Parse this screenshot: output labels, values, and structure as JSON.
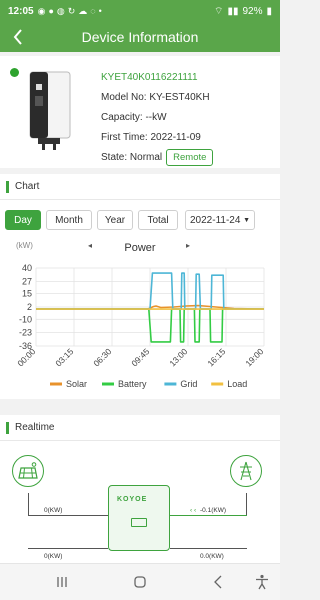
{
  "status": {
    "time": "12:05",
    "battery": "92%"
  },
  "header": {
    "title": "Device Information"
  },
  "device": {
    "serial": "KYET40K0116221111",
    "model_label": "Model No:",
    "model": "KY-EST40KH",
    "capacity_label": "Capacity:",
    "capacity": "--kW",
    "first_time_label": "First Time:",
    "first_time": "2022-11-09",
    "state_label": "State:",
    "state": "Normal",
    "remote_button": "Remote",
    "status_color": "#2ea32e"
  },
  "chart_section": {
    "title": "Chart",
    "tabs": [
      "Day",
      "Month",
      "Year",
      "Total"
    ],
    "active_tab": "Day",
    "date": "2022-11-24"
  },
  "chart_data": {
    "type": "line",
    "title": "Power",
    "ylabel": "(kW)",
    "ylim": [
      -36,
      40
    ],
    "yticks": [
      40,
      27,
      15,
      2,
      -10,
      -23,
      -36
    ],
    "xticks": [
      "00:00",
      "03:15",
      "06:30",
      "09:45",
      "13:00",
      "16:15",
      "19:00"
    ],
    "xlim_hours": [
      0,
      19
    ],
    "series": [
      {
        "name": "Solar",
        "color": "#e8922b",
        "x": [
          0,
          9.3,
          9.8,
          10.0,
          10.4,
          11.5,
          12.5,
          13.5,
          14.0,
          15.0,
          16.5,
          19
        ],
        "y": [
          0,
          0,
          2.5,
          3,
          1.5,
          2,
          3,
          3.5,
          3,
          2,
          0.5,
          0
        ]
      },
      {
        "name": "Battery",
        "color": "#33cc44",
        "x": [
          0,
          9.4,
          9.6,
          11.2,
          11.3,
          12.0,
          12.05,
          12.3,
          12.35,
          13.2,
          13.25,
          13.6,
          13.65,
          14.5,
          14.55,
          15.5,
          15.55,
          19
        ],
        "y": [
          0,
          0,
          -32,
          -32,
          0,
          0,
          -32,
          -32,
          0,
          0,
          -32,
          -32,
          0,
          0,
          -32,
          -32,
          0,
          0
        ]
      },
      {
        "name": "Grid",
        "color": "#4db6d6",
        "x": [
          0,
          9.5,
          9.7,
          11.3,
          11.4,
          12.1,
          12.15,
          12.35,
          12.4,
          13.3,
          13.35,
          13.6,
          13.7,
          14.6,
          14.65,
          15.6,
          15.65,
          19
        ],
        "y": [
          0,
          0,
          35,
          35,
          0,
          0,
          35,
          35,
          0,
          0,
          34,
          34,
          0,
          0,
          33,
          33,
          0,
          0
        ]
      },
      {
        "name": "Load",
        "color": "#f2c040",
        "x": [
          0,
          19
        ],
        "y": [
          0,
          0
        ]
      }
    ],
    "legend": [
      "Solar",
      "Battery",
      "Grid",
      "Load"
    ],
    "legend_position": "bottom"
  },
  "realtime": {
    "title": "Realtime",
    "inverter_logo": "KOYOE",
    "pv_power": "0(KW)",
    "grid_power": "-0.1(KW)",
    "battery_power": "0(KW)",
    "load_power": "0.0(KW)"
  }
}
